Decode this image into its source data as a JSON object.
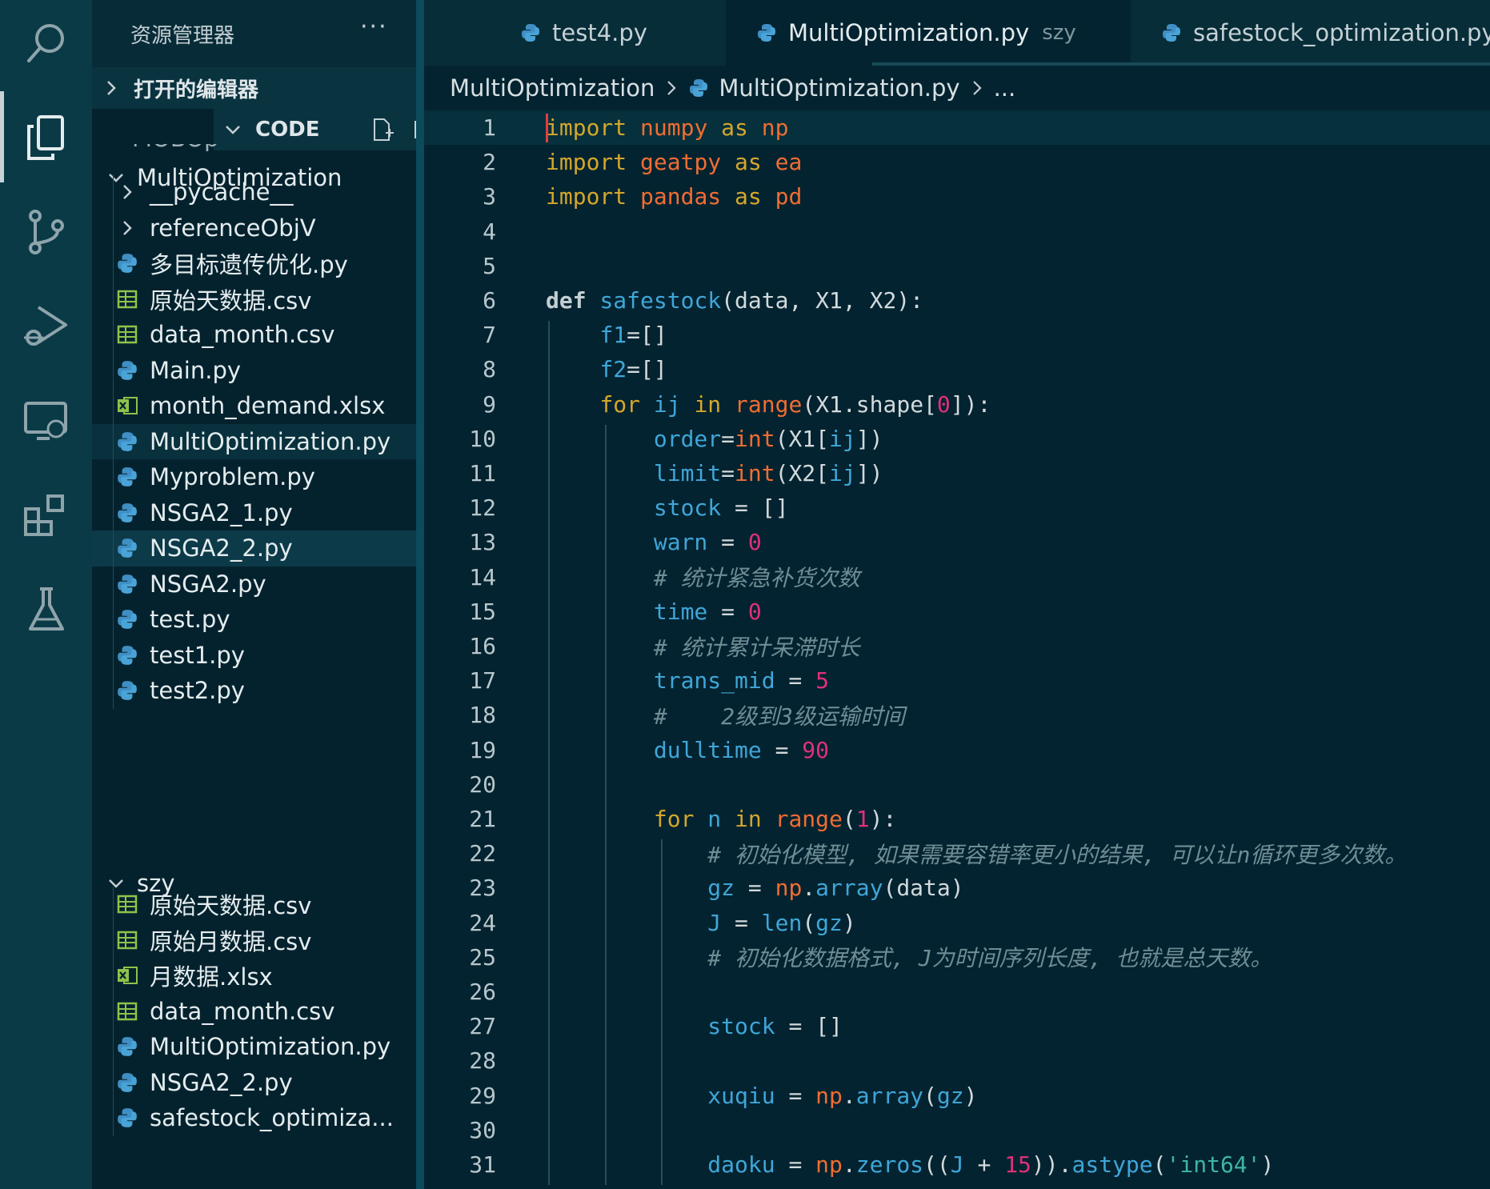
{
  "activity_bar": {
    "icons": [
      "search-icon",
      "explorer-icon",
      "source-control-icon",
      "run-debug-icon",
      "remote-explorer-icon",
      "extensions-icon",
      "testing-icon"
    ]
  },
  "sidebar": {
    "title": "资源管理器",
    "more": "···",
    "sections": {
      "open_editors": "打开的编辑器",
      "code": "CODE"
    },
    "partial_item": "MOBOp",
    "folders": {
      "multi": "MultiOptimization",
      "szy": "szy"
    },
    "multi_items": [
      {
        "label": "__pycache__",
        "type": "folder"
      },
      {
        "label": "referenceObjV",
        "type": "folder"
      },
      {
        "label": "多目标遗传优化.py",
        "type": "py"
      },
      {
        "label": "原始天数据.csv",
        "type": "csv"
      },
      {
        "label": "data_month.csv",
        "type": "csv"
      },
      {
        "label": "Main.py",
        "type": "py"
      },
      {
        "label": "month_demand.xlsx",
        "type": "xlsx"
      },
      {
        "label": "MultiOptimization.py",
        "type": "py"
      },
      {
        "label": "Myproblem.py",
        "type": "py"
      },
      {
        "label": "NSGA2_1.py",
        "type": "py"
      },
      {
        "label": "NSGA2_2.py",
        "type": "py"
      },
      {
        "label": "NSGA2.py",
        "type": "py"
      },
      {
        "label": "test.py",
        "type": "py"
      },
      {
        "label": "test1.py",
        "type": "py"
      },
      {
        "label": "test2.py",
        "type": "py"
      }
    ],
    "szy_items": [
      {
        "label": "原始天数据.csv",
        "type": "csv"
      },
      {
        "label": "原始月数据.csv",
        "type": "csv"
      },
      {
        "label": "月数据.xlsx",
        "type": "xlsx"
      },
      {
        "label": "data_month.csv",
        "type": "csv"
      },
      {
        "label": "MultiOptimization.py",
        "type": "py"
      },
      {
        "label": "NSGA2_2.py",
        "type": "py"
      },
      {
        "label": "safestock_optimiza...",
        "type": "py"
      }
    ]
  },
  "tabs": [
    {
      "label": "test4.py",
      "sub": ""
    },
    {
      "label": "MultiOptimization.py",
      "sub": "szy"
    },
    {
      "label": "safestock_optimization.py",
      "sub": ""
    }
  ],
  "breadcrumb": {
    "folder": "MultiOptimization",
    "file": "MultiOptimization.py",
    "more": "..."
  },
  "editor": {
    "line_numbers": [
      "1",
      "2",
      "3",
      "4",
      "5",
      "6",
      "7",
      "8",
      "9",
      "10",
      "11",
      "12",
      "13",
      "14",
      "15",
      "16",
      "17",
      "18",
      "19",
      "20",
      "21",
      "22",
      "23",
      "24",
      "25",
      "26",
      "27",
      "28",
      "29",
      "30",
      "31"
    ],
    "lines": [
      [
        [
          "k",
          "import"
        ],
        [
          "p",
          " "
        ],
        [
          "m",
          "numpy"
        ],
        [
          "p",
          " "
        ],
        [
          "k",
          "as"
        ],
        [
          "p",
          " "
        ],
        [
          "m",
          "np"
        ]
      ],
      [
        [
          "k",
          "import"
        ],
        [
          "p",
          " "
        ],
        [
          "m",
          "geatpy"
        ],
        [
          "p",
          " "
        ],
        [
          "k",
          "as"
        ],
        [
          "p",
          " "
        ],
        [
          "m",
          "ea"
        ]
      ],
      [
        [
          "k",
          "import"
        ],
        [
          "p",
          " "
        ],
        [
          "m",
          "pandas"
        ],
        [
          "p",
          " "
        ],
        [
          "k",
          "as"
        ],
        [
          "p",
          " "
        ],
        [
          "m",
          "pd"
        ]
      ],
      [],
      [],
      [
        [
          "kb",
          "def"
        ],
        [
          "p",
          " "
        ],
        [
          "f",
          "safestock"
        ],
        [
          "p",
          "(data, X1, X2):"
        ]
      ],
      [
        [
          "p",
          "    "
        ],
        [
          "v",
          "f1"
        ],
        [
          "p",
          "=[]"
        ]
      ],
      [
        [
          "p",
          "    "
        ],
        [
          "v",
          "f2"
        ],
        [
          "p",
          "=[]"
        ]
      ],
      [
        [
          "p",
          "    "
        ],
        [
          "k",
          "for"
        ],
        [
          "p",
          " "
        ],
        [
          "v",
          "ij"
        ],
        [
          "p",
          " "
        ],
        [
          "k",
          "in"
        ],
        [
          "p",
          " "
        ],
        [
          "b",
          "range"
        ],
        [
          "p",
          "(X1.shape["
        ],
        [
          "n",
          "0"
        ],
        [
          "p",
          "]):"
        ]
      ],
      [
        [
          "p",
          "        "
        ],
        [
          "v",
          "order"
        ],
        [
          "p",
          "="
        ],
        [
          "b",
          "int"
        ],
        [
          "p",
          "(X1["
        ],
        [
          "v",
          "ij"
        ],
        [
          "p",
          "])"
        ]
      ],
      [
        [
          "p",
          "        "
        ],
        [
          "v",
          "limit"
        ],
        [
          "p",
          "="
        ],
        [
          "b",
          "int"
        ],
        [
          "p",
          "(X2["
        ],
        [
          "v",
          "ij"
        ],
        [
          "p",
          "])"
        ]
      ],
      [
        [
          "p",
          "        "
        ],
        [
          "v",
          "stock"
        ],
        [
          "p",
          " = []"
        ]
      ],
      [
        [
          "p",
          "        "
        ],
        [
          "v",
          "warn"
        ],
        [
          "p",
          " = "
        ],
        [
          "n",
          "0"
        ]
      ],
      [
        [
          "p",
          "        "
        ],
        [
          "c",
          "# 统计紧急补货次数"
        ]
      ],
      [
        [
          "p",
          "        "
        ],
        [
          "v",
          "time"
        ],
        [
          "p",
          " = "
        ],
        [
          "n",
          "0"
        ]
      ],
      [
        [
          "p",
          "        "
        ],
        [
          "c",
          "# 统计累计呆滞时长"
        ]
      ],
      [
        [
          "p",
          "        "
        ],
        [
          "v",
          "trans_mid"
        ],
        [
          "p",
          " = "
        ],
        [
          "n",
          "5"
        ]
      ],
      [
        [
          "p",
          "        "
        ],
        [
          "c",
          "#    2级到3级运输时间"
        ]
      ],
      [
        [
          "p",
          "        "
        ],
        [
          "v",
          "dulltime"
        ],
        [
          "p",
          " = "
        ],
        [
          "n",
          "90"
        ]
      ],
      [],
      [
        [
          "p",
          "        "
        ],
        [
          "k",
          "for"
        ],
        [
          "p",
          " "
        ],
        [
          "v",
          "n"
        ],
        [
          "p",
          " "
        ],
        [
          "k",
          "in"
        ],
        [
          "p",
          " "
        ],
        [
          "b",
          "range"
        ],
        [
          "p",
          "("
        ],
        [
          "n",
          "1"
        ],
        [
          "p",
          "):"
        ]
      ],
      [
        [
          "p",
          "            "
        ],
        [
          "c",
          "# 初始化模型, 如果需要容错率更小的结果, 可以让n循环更多次数。"
        ]
      ],
      [
        [
          "p",
          "            "
        ],
        [
          "v",
          "gz"
        ],
        [
          "p",
          " = "
        ],
        [
          "m",
          "np"
        ],
        [
          "p",
          "."
        ],
        [
          "f",
          "array"
        ],
        [
          "p",
          "(data)"
        ]
      ],
      [
        [
          "p",
          "            "
        ],
        [
          "v",
          "J"
        ],
        [
          "p",
          " = "
        ],
        [
          "f",
          "len"
        ],
        [
          "p",
          "("
        ],
        [
          "v",
          "gz"
        ],
        [
          "p",
          ")"
        ]
      ],
      [
        [
          "p",
          "            "
        ],
        [
          "c",
          "# 初始化数据格式, J为时间序列长度, 也就是总天数。"
        ]
      ],
      [],
      [
        [
          "p",
          "            "
        ],
        [
          "v",
          "stock"
        ],
        [
          "p",
          " = []"
        ]
      ],
      [],
      [
        [
          "p",
          "            "
        ],
        [
          "v",
          "xuqiu"
        ],
        [
          "p",
          " = "
        ],
        [
          "m",
          "np"
        ],
        [
          "p",
          "."
        ],
        [
          "f",
          "array"
        ],
        [
          "p",
          "("
        ],
        [
          "v",
          "gz"
        ],
        [
          "p",
          ")"
        ]
      ],
      [],
      [
        [
          "p",
          "            "
        ],
        [
          "v",
          "daoku"
        ],
        [
          "p",
          " = "
        ],
        [
          "m",
          "np"
        ],
        [
          "p",
          "."
        ],
        [
          "f",
          "zeros"
        ],
        [
          "p",
          "(("
        ],
        [
          "v",
          "J"
        ],
        [
          "p",
          " + "
        ],
        [
          "n",
          "15"
        ],
        [
          "p",
          "))."
        ],
        [
          "f",
          "astype"
        ],
        [
          "p",
          "("
        ],
        [
          "s",
          "'int64'"
        ],
        [
          "p",
          ")"
        ]
      ]
    ]
  },
  "colors": {
    "background": "#042330",
    "activity_bar": "#0b3a47",
    "sidebar": "#04222e",
    "keyword": "#d4a72c",
    "module": "#f06d32",
    "identifier": "#3fa6d8",
    "number": "#e0307a",
    "comment": "#6f8d95"
  }
}
